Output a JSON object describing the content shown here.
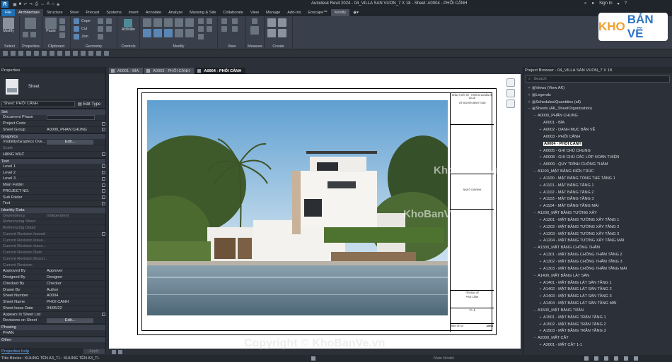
{
  "titlebar": {
    "app_logo": "R",
    "title": "Autodesk Revit 2024 - 04_VILLA SAN VUON_7 X 18 - Sheet: A0004 - PHỐI CẢNH",
    "sign_in": "Sign In"
  },
  "ribbon": {
    "tabs": [
      "File",
      "Architecture",
      "Structure",
      "Steel",
      "Precast",
      "Systems",
      "Insert",
      "Annotate",
      "Analyze",
      "Massing & Site",
      "Collaborate",
      "View",
      "Manage",
      "Add-Ins",
      "Enscape™",
      "Modify"
    ],
    "modify_label": "Modify",
    "panels": {
      "select": "Select",
      "properties": "Properties",
      "clipboard": "Clipboard",
      "geometry": "Geometry",
      "controls": "Controls",
      "modify": "Modify",
      "view": "View",
      "measure": "Measure",
      "create": "Create"
    },
    "clipboard_paste": "Paste",
    "geometry_items": [
      "Cope",
      "Cut",
      "Join"
    ],
    "activate_label": "Activate"
  },
  "properties": {
    "header": "Properties",
    "type_name": "Sheet",
    "filter_value": "Sheet: PHỐI CẢNH",
    "edit_type": "Edit Type",
    "sections": {
      "set": "Set",
      "graphics": "Graphics",
      "text": "Text",
      "identity": "Identity Data",
      "phasing": "Phasing",
      "other": "Other"
    },
    "set_rows": [
      {
        "k": "Document Phase",
        "v": ""
      },
      {
        "k": "Project Code",
        "v": ""
      },
      {
        "k": "Sheet Group",
        "v": "A0000_PHẦN CHUNG"
      }
    ],
    "graphics_rows": [
      {
        "k": "Visibility/Graphics Ove...",
        "v": "Edit..."
      },
      {
        "k": "Scale",
        "v": ""
      },
      {
        "k": "HẠNG MỤC",
        "v": ""
      }
    ],
    "text_rows": [
      "Level 1",
      "Level 2",
      "Level 3",
      "Main Folder",
      "PROJECT NO.",
      "Sub Folder",
      "Text"
    ],
    "identity_rows": [
      {
        "k": "Dependency",
        "v": "Independent",
        "dim": true
      },
      {
        "k": "Referencing Sheet",
        "v": "",
        "dim": true
      },
      {
        "k": "Referencing Detail",
        "v": "",
        "dim": true
      },
      {
        "k": "Current Revision Issued",
        "v": "",
        "dim": true
      },
      {
        "k": "Current Revision Issue...",
        "v": "",
        "dim": true
      },
      {
        "k": "Current Revision Issue...",
        "v": "",
        "dim": true
      },
      {
        "k": "Current Revision Date",
        "v": "",
        "dim": true
      },
      {
        "k": "Current Revision Descri...",
        "v": "",
        "dim": true
      },
      {
        "k": "Current Revision",
        "v": "",
        "dim": true
      },
      {
        "k": "Approved By",
        "v": "Approver"
      },
      {
        "k": "Designed By",
        "v": "Designer"
      },
      {
        "k": "Checked By",
        "v": "Checker"
      },
      {
        "k": "Drawn By",
        "v": "Author"
      },
      {
        "k": "Sheet Number",
        "v": "A0004"
      },
      {
        "k": "Sheet Name",
        "v": "PHỐI CẢNH"
      },
      {
        "k": "Sheet Issue Date",
        "v": "04/05/22"
      },
      {
        "k": "Appears In Sheet List",
        "v": ""
      },
      {
        "k": "Revisions on Sheet",
        "v": "Edit..."
      }
    ],
    "phasing_value": "PHẦN",
    "help_link": "Properties help",
    "apply": "Apply"
  },
  "view_tabs": [
    "A0001 - BÌA",
    "A0003 - PHỐI CẢNH",
    "A0004 - PHỐI CẢNH"
  ],
  "title_block": {
    "firm": "NHẬN THIẾT KẾ - TRIỂN KHAI BẢN VẼ 2D-3D",
    "designer": "VÕ NGUYỄN MINH TOÀN",
    "project": "NHÀ Ở GIA ĐÌNH",
    "title_label": "TÊN BẢN VẼ",
    "title_value": "PHỐI CẢNH",
    "scale_label": "TỶ LỆ",
    "sheet_label": "BẢN VẼ SỐ",
    "sheet_no": "A0004"
  },
  "browser": {
    "header": "Project Browser - 04_VILLA SAN VUON_7 X 18",
    "search_placeholder": "Search",
    "items": [
      {
        "t": "Views (View AK)",
        "lvl": 0,
        "tg": "+"
      },
      {
        "t": "Legends",
        "lvl": 0,
        "tg": "+"
      },
      {
        "t": "Schedules/Quantities (all)",
        "lvl": 0,
        "tg": "+"
      },
      {
        "t": "Sheets (AK_SheetOrganization)",
        "lvl": 0,
        "tg": "−"
      },
      {
        "t": "A0000_PHẦN CHUNG",
        "lvl": 1,
        "tg": "−"
      },
      {
        "t": "A0001 - BÌA",
        "lvl": 2,
        "tg": ""
      },
      {
        "t": "A0002 - DANH MỤC BẢN VẼ",
        "lvl": 2,
        "tg": "+"
      },
      {
        "t": "A0003 - PHỐI CẢNH",
        "lvl": 2,
        "tg": ""
      },
      {
        "t": "A0004 - PHỐI CẢNH",
        "lvl": 2,
        "tg": "",
        "sel": true
      },
      {
        "t": "A0005 - GHI CHÚ CHUNG",
        "lvl": 2,
        "tg": "+"
      },
      {
        "t": "A0008 - GHI CHÚ CÁC LỚP HOÀN THIỆN",
        "lvl": 2,
        "tg": "+"
      },
      {
        "t": "A0009 - QUY TRÌNH CHỐNG THẤM",
        "lvl": 2,
        "tg": "+"
      },
      {
        "t": "A1100_MẶT BẰNG KIẾN TRÚC",
        "lvl": 1,
        "tg": "−"
      },
      {
        "t": "A1100 - MẶT BẰNG TỔNG THỂ TẦNG 1",
        "lvl": 2,
        "tg": "+"
      },
      {
        "t": "A1101 - MẶT BẰNG TẦNG 1",
        "lvl": 2,
        "tg": "+"
      },
      {
        "t": "A1102 - MẶT BẰNG TẦNG 2",
        "lvl": 2,
        "tg": "+"
      },
      {
        "t": "A1103 - MẶT BẰNG TẦNG 3",
        "lvl": 2,
        "tg": "+"
      },
      {
        "t": "A1104 - MẶT BẰNG TẦNG MÁI",
        "lvl": 2,
        "tg": "+"
      },
      {
        "t": "A1200_MẶT BẰNG TƯỜNG XÂY",
        "lvl": 1,
        "tg": "−"
      },
      {
        "t": "A1201 - MẶT BẰNG TƯỜNG XÂY TẦNG 1",
        "lvl": 2,
        "tg": "+"
      },
      {
        "t": "A1202 - MẶT BẰNG TƯỜNG XÂY TẦNG 2",
        "lvl": 2,
        "tg": "+"
      },
      {
        "t": "A1203 - MẶT BẰNG TƯỜNG XÂY TẦNG 3",
        "lvl": 2,
        "tg": "+"
      },
      {
        "t": "A1204 - MẶT BẰNG TƯỜNG XÂY TẦNG MÁI",
        "lvl": 2,
        "tg": "+"
      },
      {
        "t": "A1300_MẶT BẰNG CHỐNG THẤM",
        "lvl": 1,
        "tg": "−"
      },
      {
        "t": "A1301 - MẶT BẰNG CHỐNG THẤM TẦNG 2",
        "lvl": 2,
        "tg": "+"
      },
      {
        "t": "A1302 - MẶT BẰNG CHỐNG THẤM TẦNG 3",
        "lvl": 2,
        "tg": "+"
      },
      {
        "t": "A1303 - MẶT BẰNG CHỐNG THẤM TẦNG MÁI",
        "lvl": 2,
        "tg": "+"
      },
      {
        "t": "A1400_MẶT BẰNG LÁT SÀN",
        "lvl": 1,
        "tg": "−"
      },
      {
        "t": "A1401 - MẶT BẰNG LÁT SÀN TẦNG 1",
        "lvl": 2,
        "tg": "+"
      },
      {
        "t": "A1402 - MẶT BẰNG LÁT SÀN TẦNG 2",
        "lvl": 2,
        "tg": "+"
      },
      {
        "t": "A1403 - MẶT BẰNG LÁT SÀN TẦNG 3",
        "lvl": 2,
        "tg": "+"
      },
      {
        "t": "A1404 - MẶT BẰNG LÁT SÀN TẦNG MÁI",
        "lvl": 2,
        "tg": "+"
      },
      {
        "t": "A1500_MẶT BẰNG TRẦN",
        "lvl": 1,
        "tg": "−"
      },
      {
        "t": "A1501 - MẶT BẰNG TRẦN TẦNG 1",
        "lvl": 2,
        "tg": "+"
      },
      {
        "t": "A1502 - MẶT BẰNG TRẦN TẦNG 2",
        "lvl": 2,
        "tg": "+"
      },
      {
        "t": "A1503 - MẶT BẰNG TRẦN TẦNG 3",
        "lvl": 2,
        "tg": "+"
      },
      {
        "t": "A2000_MẶT CẮT",
        "lvl": 1,
        "tg": "−"
      },
      {
        "t": "A2001 - MẶT CẮT 1-1",
        "lvl": 2,
        "tg": "+"
      }
    ]
  },
  "status": {
    "left": "Title Blocks : KHUNG TÊN A3_TL : KHUNG TÊN A3_TL",
    "model": "Main Model"
  },
  "watermark": {
    "logo_a": "KHO",
    "logo_b": "BẢN VẼ",
    "text1": "KhoBanVe.vn",
    "text2": "KhoBanVe.vn",
    "copyright": "Copyright © KhoBanVe.vn"
  },
  "colors": {
    "accent": "#1f6fb6",
    "panel": "#2b3039",
    "ribbon": "#3a404b"
  }
}
